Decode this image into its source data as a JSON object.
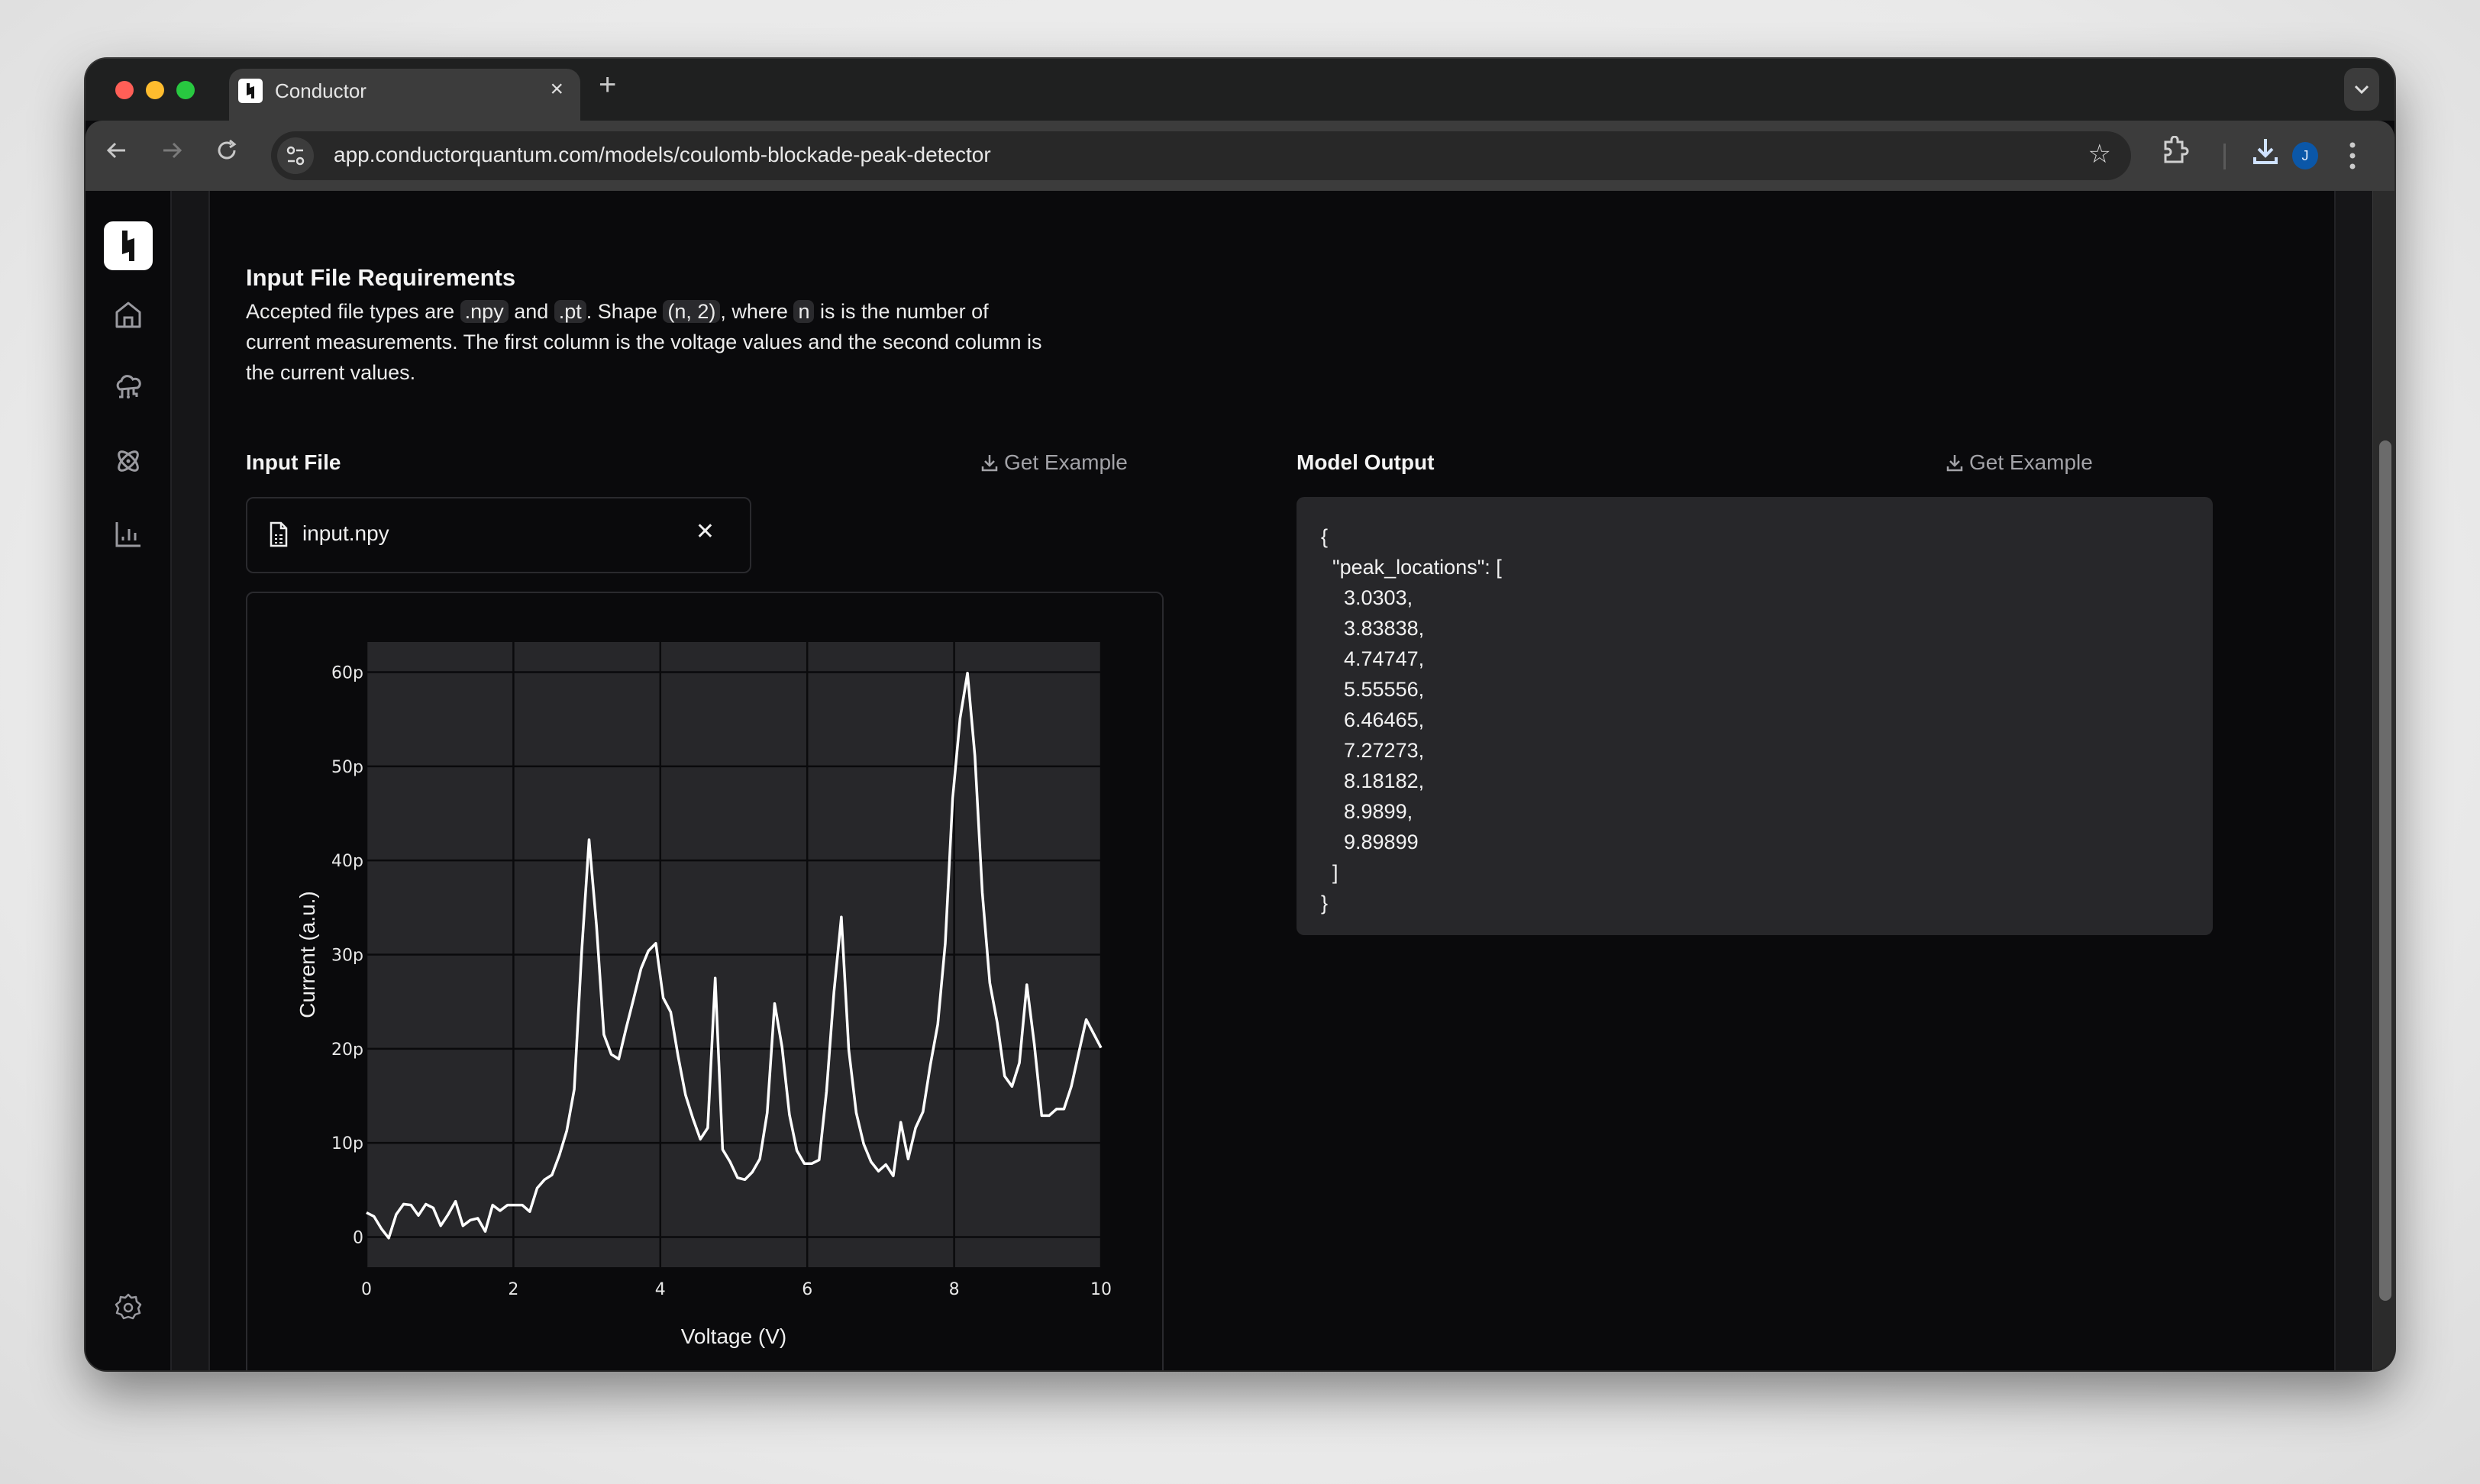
{
  "browser": {
    "tab_title": "Conductor",
    "url": "app.conductorquantum.com/models/coulomb-blockade-peak-detector",
    "avatar_initial": "J",
    "traffic_colors": {
      "close": "#ff5f57",
      "minimize": "#febc2e",
      "zoom": "#28c840"
    }
  },
  "sidebar": {
    "items": [
      {
        "name": "home",
        "icon": "home-icon"
      },
      {
        "name": "cloud-compute",
        "icon": "cloud-network-icon"
      },
      {
        "name": "models",
        "icon": "atom-icon"
      },
      {
        "name": "analytics",
        "icon": "bar-chart-icon"
      }
    ],
    "settings_icon": "gear-icon"
  },
  "requirements": {
    "title": "Input File Requirements",
    "text_1": "Accepted file types are ",
    "code_npy": ".npy",
    "text_2": " and ",
    "code_pt": ".pt",
    "text_3": ". Shape ",
    "code_shape": "(n, 2)",
    "text_4": ", where ",
    "code_n": "n",
    "text_5": " is is the number of current measurements. The first column is the voltage values and the second column is the current values."
  },
  "input_panel": {
    "label": "Input File",
    "get_example": "Get Example",
    "file_name": "input.npy",
    "remove_icon": "close-icon"
  },
  "output_panel": {
    "label": "Model Output",
    "get_example": "Get Example",
    "json_text": "{\n  \"peak_locations\": [\n    3.0303,\n    3.83838,\n    4.74747,\n    5.55556,\n    6.46465,\n    7.27273,\n    8.18182,\n    8.9899,\n    9.89899\n  ]\n}"
  },
  "colors": {
    "line": "#ffffff",
    "plot_bg": "#27272a",
    "grid": "#0a0a0c",
    "accent_avatar": "#0b57a8"
  },
  "chart_data": {
    "type": "line",
    "title": "",
    "xlabel": "Voltage (V)",
    "ylabel": "Current (a.u.)",
    "xlim": [
      0,
      10
    ],
    "ylim": [
      -3.2,
      63.2
    ],
    "xticks": [
      0,
      2,
      4,
      6,
      8,
      10
    ],
    "xtick_labels": [
      "0",
      "2",
      "4",
      "6",
      "8",
      "10"
    ],
    "yticks": [
      0,
      10,
      20,
      30,
      40,
      50,
      60
    ],
    "ytick_labels": [
      "0",
      "10p",
      "20p",
      "30p",
      "40p",
      "50p",
      "60p"
    ],
    "y_unit": "pA (p = 1e-12)",
    "grid": true,
    "legend": "none",
    "series": [
      {
        "name": "current",
        "x": [
          0.0,
          0.101,
          0.202,
          0.303,
          0.404,
          0.505,
          0.606,
          0.707,
          0.808,
          0.909,
          1.01,
          1.111,
          1.212,
          1.313,
          1.414,
          1.515,
          1.616,
          1.717,
          1.818,
          1.919,
          2.02,
          2.121,
          2.222,
          2.323,
          2.424,
          2.525,
          2.626,
          2.727,
          2.828,
          2.929,
          3.03,
          3.131,
          3.232,
          3.333,
          3.434,
          3.535,
          3.636,
          3.737,
          3.838,
          3.939,
          4.04,
          4.141,
          4.242,
          4.343,
          4.444,
          4.545,
          4.646,
          4.747,
          4.848,
          4.949,
          5.051,
          5.152,
          5.253,
          5.354,
          5.455,
          5.556,
          5.657,
          5.758,
          5.859,
          5.96,
          6.061,
          6.162,
          6.263,
          6.364,
          6.465,
          6.566,
          6.667,
          6.768,
          6.869,
          6.97,
          7.071,
          7.172,
          7.273,
          7.374,
          7.475,
          7.576,
          7.677,
          7.778,
          7.879,
          7.98,
          8.081,
          8.182,
          8.283,
          8.384,
          8.485,
          8.586,
          8.687,
          8.788,
          8.889,
          8.99,
          9.091,
          9.192,
          9.293,
          9.394,
          9.495,
          9.596,
          9.697,
          9.798,
          9.899,
          10.0
        ],
        "y": [
          2.6,
          2.2,
          0.9,
          -0.1,
          2.4,
          3.5,
          3.4,
          2.3,
          3.5,
          3.1,
          1.2,
          2.4,
          3.8,
          1.2,
          1.8,
          2.0,
          0.6,
          3.4,
          2.8,
          3.4,
          3.4,
          3.4,
          2.7,
          5.2,
          6.1,
          6.6,
          8.7,
          11.3,
          15.7,
          30.3,
          42.2,
          33.1,
          21.5,
          19.4,
          18.9,
          22.2,
          25.3,
          28.5,
          30.4,
          31.2,
          25.4,
          23.9,
          19.2,
          15.1,
          12.6,
          10.4,
          11.6,
          27.5,
          9.3,
          8.0,
          6.3,
          6.1,
          6.9,
          8.3,
          13.2,
          24.8,
          20.2,
          13.0,
          9.2,
          7.8,
          7.8,
          8.2,
          15.5,
          26.0,
          34.0,
          19.9,
          13.2,
          9.9,
          8.0,
          7.0,
          7.7,
          6.5,
          12.2,
          8.3,
          11.6,
          13.3,
          18.3,
          22.6,
          31.2,
          46.6,
          55.1,
          59.9,
          51.1,
          36.6,
          27.0,
          22.8,
          17.1,
          16.0,
          18.5,
          26.8,
          20.5,
          12.9,
          12.9,
          13.6,
          13.6,
          16.0,
          19.6,
          23.1,
          21.6,
          20.1
        ]
      }
    ]
  }
}
